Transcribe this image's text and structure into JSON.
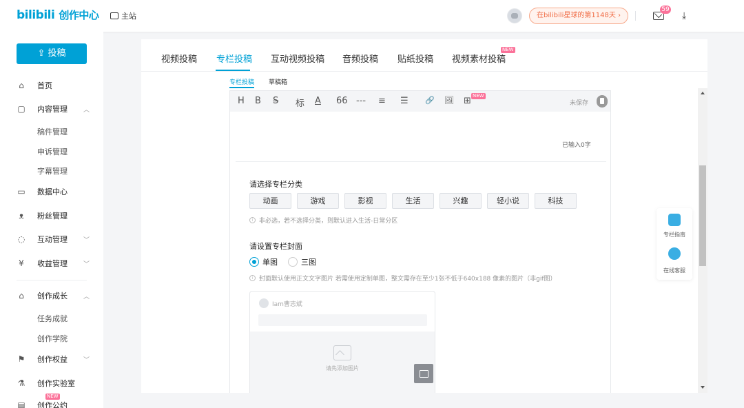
{
  "header": {
    "logo_text": "bilibili",
    "logo_suffix": "创作中心",
    "home_link": "主站",
    "planet_days": "在bilibili星球的第1148天 ›",
    "mail_badge": "59",
    "icons": [
      "tv-icon",
      "avatar",
      "mail-icon",
      "download-icon"
    ]
  },
  "sidebar": {
    "upload_label": "投稿",
    "items": [
      {
        "label": "首页",
        "icon": "home-icon"
      },
      {
        "label": "内容管理",
        "icon": "document-icon",
        "chevron": "︿"
      },
      {
        "label": "稿件管理"
      },
      {
        "label": "申诉管理"
      },
      {
        "label": "字幕管理"
      },
      {
        "label": "数据中心",
        "icon": "chart-icon"
      },
      {
        "label": "粉丝管理",
        "icon": "fans-icon"
      },
      {
        "label": "互动管理",
        "icon": "interaction-icon",
        "chevron": "﹀"
      },
      {
        "label": "收益管理",
        "icon": "income-icon",
        "chevron": "﹀"
      },
      {
        "label": "创作成长",
        "icon": "growth-icon",
        "chevron": "︿"
      },
      {
        "label": "任务成就"
      },
      {
        "label": "创作学院"
      },
      {
        "label": "创作权益",
        "icon": "flag-icon",
        "chevron": "﹀"
      },
      {
        "label": "创作实验室",
        "icon": "lab-icon"
      },
      {
        "label": "创作公约",
        "icon": "contract-icon",
        "badge": "NEW"
      }
    ]
  },
  "main": {
    "tabs": [
      {
        "label": "视频投稿"
      },
      {
        "label": "专栏投稿",
        "active": true
      },
      {
        "label": "互动视频投稿"
      },
      {
        "label": "音频投稿"
      },
      {
        "label": "贴纸投稿"
      },
      {
        "label": "视频素材投稿",
        "badge": "NEW"
      }
    ],
    "subtabs": [
      {
        "label": "专栏投稿",
        "active": true
      },
      {
        "label": "草稿箱"
      }
    ],
    "toolbar": {
      "buttons": [
        "H",
        "B",
        "S",
        "标",
        "A",
        "66",
        "---",
        "≡",
        "☰",
        "🔗",
        "🖼",
        "⊞"
      ],
      "unsaved": "未保存",
      "new_badge": "NEW"
    },
    "char_count": "已输入0字",
    "category": {
      "title": "请选择专栏分类",
      "options": [
        "动画",
        "游戏",
        "影视",
        "生活",
        "兴趣",
        "轻小说",
        "科技"
      ],
      "hint": "非必选，若不选择分类，则默认进入生活-日常分区"
    },
    "cover": {
      "title": "请设置专栏封面",
      "options": [
        {
          "label": "单图",
          "checked": true
        },
        {
          "label": "三图",
          "checked": false
        }
      ],
      "hint": "封面默认使用正文文字图片 若需使用定制单图，整文需存在至少1张不低于640x188 像素的图片（非gif图）",
      "preview_user": "Iam曹志斌",
      "add_image": "请先添加图片"
    }
  },
  "float": {
    "guide_label": "专栏指南",
    "service_label": "在线客服"
  },
  "colors": {
    "accent": "#00a1d6",
    "pink": "#fb7299",
    "orange": "#f06c45"
  }
}
